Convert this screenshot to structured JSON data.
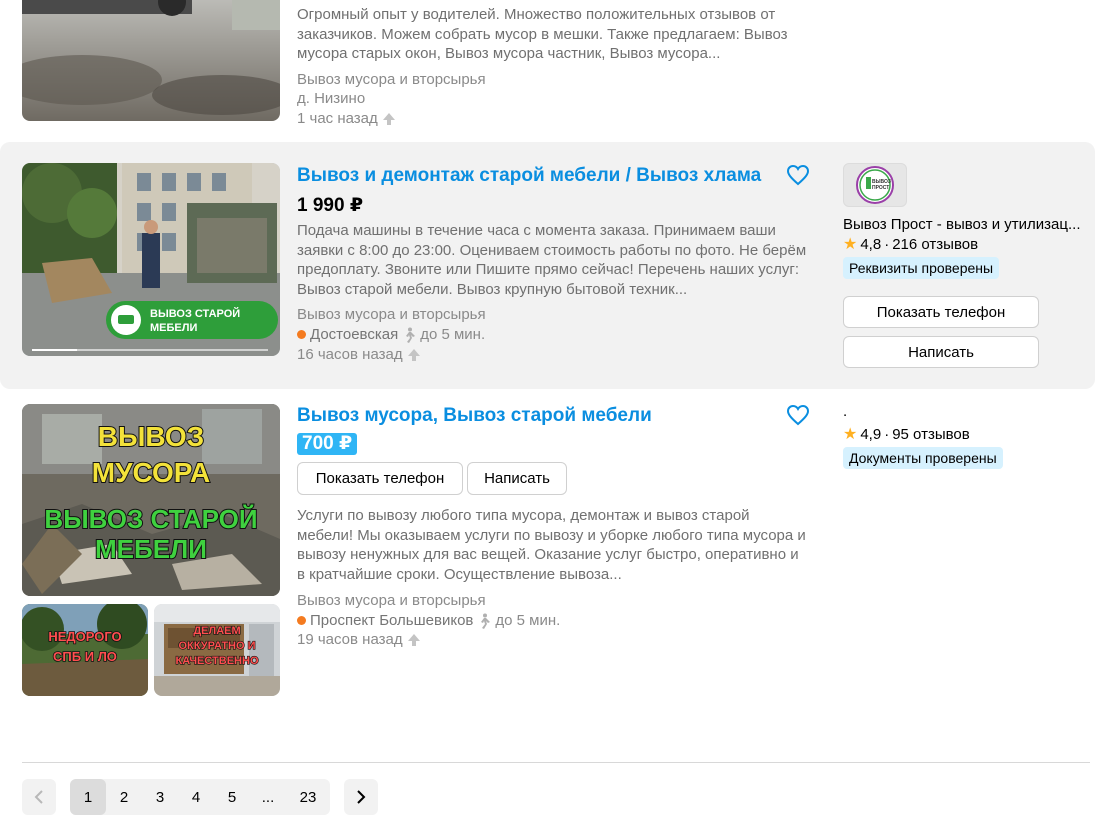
{
  "listings": [
    {
      "title": "",
      "description": "Огромный опыт у водителей. Множество положительных отзывов от заказчиков. Можем собрать мусор в мешки. Также предлагаем: Вывоз мусора старых окон, Вывоз мусора частник, Вывоз мусора...",
      "category": "Вывоз мусора и вторсырья",
      "location": "д. Низино",
      "time": "1 час назад"
    },
    {
      "title": "Вывоз и демонтаж старой мебели / Вывоз хлама",
      "price": "1 990 ₽",
      "description": "Подача машины в течение часа с момента заказа. Принимаем ваши заявки с 8:00 до 23:00. Оцениваем стоимость работы по фото. Не берём предоплату. Звоните или Пишите прямо сейчас! Перечень наших услуг: Вывоз старой мебели. Вывоз крупную бытовой техник...",
      "category": "Вывоз мусора и вторсырья",
      "metro": "Достоевская",
      "walk": "до 5 мин.",
      "time": "16 часов назад",
      "image_caption_1": "ВЫВОЗ СТАРОЙ",
      "image_caption_2": "МЕБЕЛИ",
      "seller": {
        "name": "Вывоз Прост - вывоз и утилизац...",
        "rating": "4,8",
        "reviews": "216 отзывов",
        "badge": "Реквизиты проверены",
        "logo_text_1": "ВЫВОЗ",
        "logo_text_2": "ПРОСТ"
      },
      "show_phone": "Показать телефон",
      "write": "Написать"
    },
    {
      "title": "Вывоз мусора, Вывоз старой мебели",
      "price": "700 ₽",
      "show_phone": "Показать телефон",
      "write": "Написать",
      "description": "Услуги по вывозу любого типа мусора, демонтаж и вывоз старой мебели! Мы оказываем услуги по вывозу и уборке любого типа мусора и вывозу ненужных для вас вещей. Оказание услуг быстро, оперативно и в кратчайшие сроки. Осуществление вывоза...",
      "category": "Вывоз мусора и вторсырья",
      "metro": "Проспект Большевиков",
      "walk": "до 5 мин.",
      "time": "19 часов назад",
      "image_caption_1": "ВЫВОЗ",
      "image_caption_2": "МУСОРА",
      "image_caption_3": "ВЫВОЗ СТАРОЙ",
      "image_caption_4": "МЕБЕЛИ",
      "thumb2_caption_1": "НЕДОРОГО",
      "thumb2_caption_2": "СПБ И ЛО",
      "thumb3_caption_1": "ДЕЛАЕМ",
      "thumb3_caption_2": "ОККУРАТНО И",
      "thumb3_caption_3": "КАЧЕСТВЕННО",
      "seller": {
        "name": ".",
        "rating": "4,9",
        "reviews": "95 отзывов",
        "badge": "Документы проверены"
      }
    }
  ],
  "pagination": {
    "pages": [
      "1",
      "2",
      "3",
      "4",
      "5",
      "...",
      "23"
    ],
    "active": "1"
  },
  "colors": {
    "title": "#0a8ee0",
    "price_pill": "#2fb5f5",
    "badge": "#d6f1fe",
    "metro_dot": "#f47b20",
    "star": "#ffb021"
  },
  "icons": [
    "heart-icon",
    "walk-icon",
    "arrow-up-icon",
    "star-icon",
    "chevron-left-icon",
    "chevron-right-icon"
  ]
}
